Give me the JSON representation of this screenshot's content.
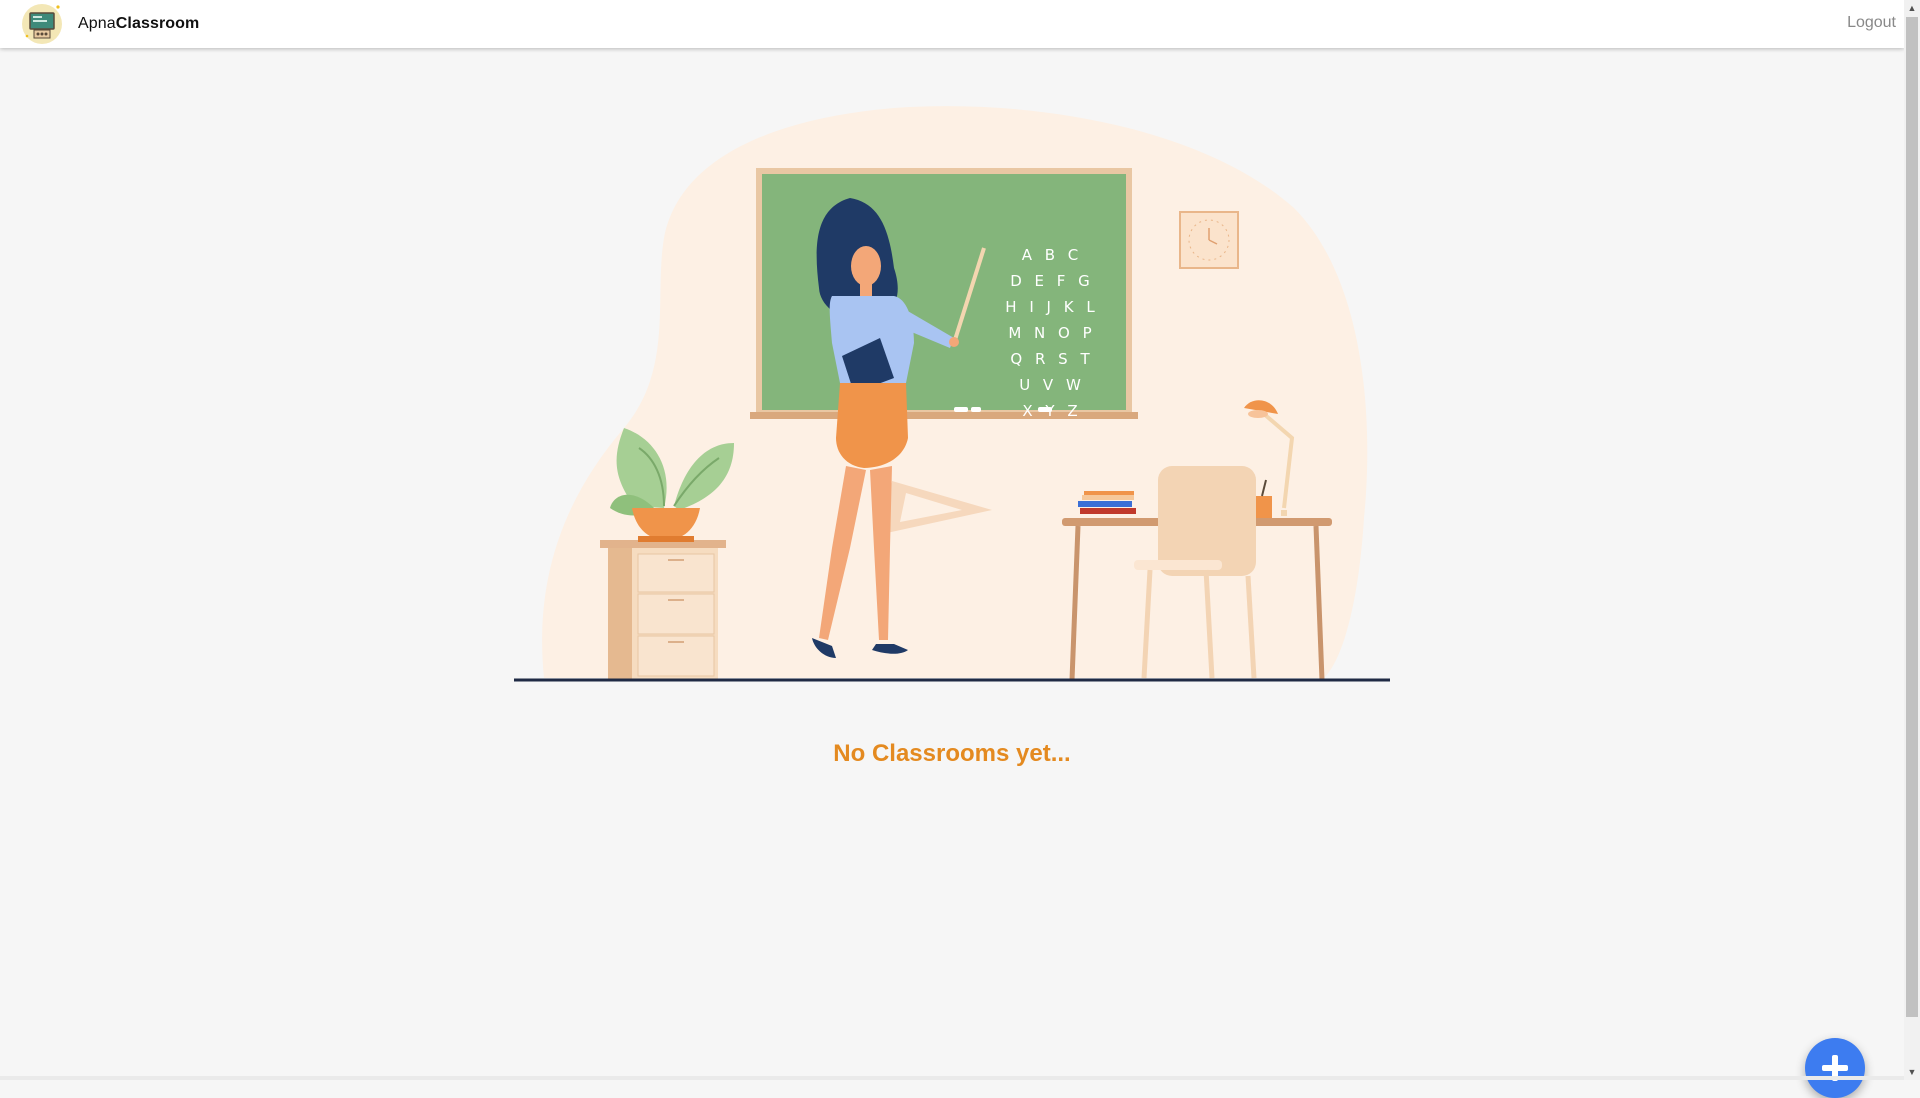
{
  "app": {
    "brand_prefix": "Apna",
    "brand_bold": "Classroom",
    "logo_icon": "classroom-logo-icon"
  },
  "nav": {
    "logout_label": "Logout"
  },
  "illustration": {
    "name": "teacher-at-chalkboard-illustration",
    "chalkboard_rows": [
      "A B C",
      "D E F G",
      "H I J K L",
      "M N O P",
      "Q R S T",
      "U V W",
      "X Y Z"
    ]
  },
  "main": {
    "empty_message": "No Classrooms yet..."
  },
  "fab": {
    "icon": "plus-icon"
  },
  "colors": {
    "accent_orange": "#e48a20",
    "fab_blue": "#3d7cf0",
    "chalkboard_green": "#84b57b",
    "background": "#f6f6f6"
  }
}
